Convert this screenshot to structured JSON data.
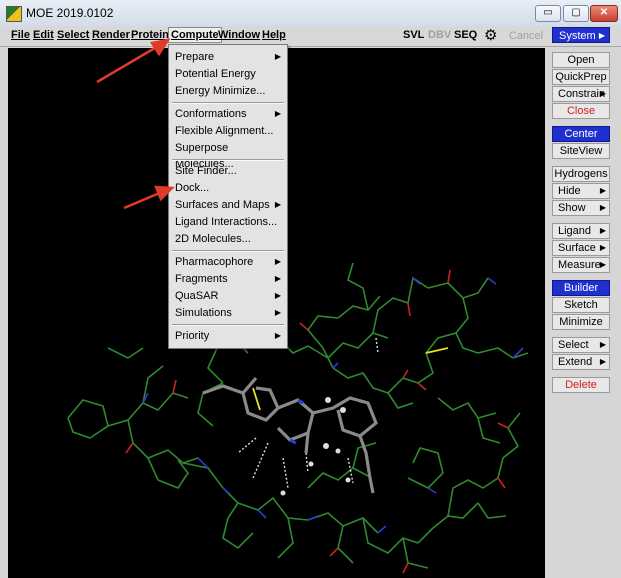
{
  "window": {
    "title": "MOE 2019.0102",
    "min": "▭",
    "max": "▢",
    "close": "✕"
  },
  "menubar": {
    "items": [
      "File",
      "Edit",
      "Select",
      "Render",
      "Protein",
      "Compute",
      "Window",
      "Help"
    ],
    "svl": "SVL",
    "dbv": "DBV",
    "seq": "SEQ",
    "cancel": "Cancel",
    "system": "System",
    "gear_icon": "gear-icon"
  },
  "compute_menu": {
    "groups": [
      [
        "Prepare",
        "Potential Energy",
        "Energy Minimize..."
      ],
      [
        "Conformations",
        "Flexible Alignment...",
        "Superpose Molecules..."
      ],
      [
        "Site Finder...",
        "Dock...",
        "Surfaces and Maps",
        "Ligand Interactions...",
        "2D Molecules..."
      ],
      [
        "Pharmacophore",
        "Fragments",
        "QuaSAR",
        "Simulations"
      ],
      [
        "Priority"
      ]
    ],
    "submenu_items": [
      "Prepare",
      "Conformations",
      "Surfaces and Maps",
      "Pharmacophore",
      "Fragments",
      "QuaSAR",
      "Simulations",
      "Priority"
    ]
  },
  "sidebar": {
    "buttons": [
      "Open",
      "QuickPrep",
      "Constrain",
      "Close",
      "Center",
      "SiteView",
      "Hydrogens",
      "Hide",
      "Show",
      "Ligand",
      "Surface",
      "Measure",
      "Builder",
      "Sketch",
      "Minimize",
      "Select",
      "Extend",
      "Delete"
    ]
  },
  "colors": {
    "accent": "#1f2fd0",
    "delete": "#d02020",
    "arrow": "#e23a2a",
    "protein": "#2f8a2f",
    "ligand": "#8a8a8a"
  }
}
